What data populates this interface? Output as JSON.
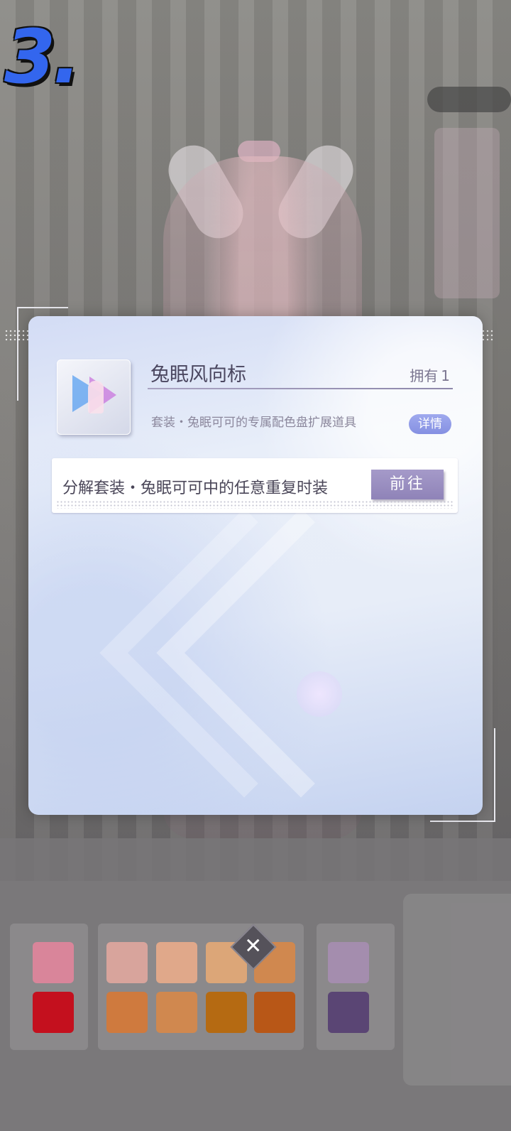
{
  "overlay": {
    "step_number": "3."
  },
  "dialog": {
    "item_name": "兔眠风向标",
    "owned_label": "拥有",
    "owned_count": "1",
    "description": "套装・兔眠可可的专属配色盘扩展道具",
    "detail_button": "详情",
    "source_text": "分解套装・兔眠可可中的任意重复时装",
    "go_button": "前往"
  },
  "close_icon": "close-icon",
  "colors": {
    "dialog_bg": "#e8eef9",
    "detail_button": "#8f98e6",
    "go_button": "#9a8ec2",
    "step_number": "#3366ee"
  },
  "palette_swatches": [
    "#d9859a",
    "#c4101e",
    "#d8a49c",
    "#e0a88a",
    "#dca678",
    "#d0884f",
    "#cf7a3e",
    "#b56a12",
    "#b85717",
    "#a48dae",
    "#5a4574"
  ]
}
